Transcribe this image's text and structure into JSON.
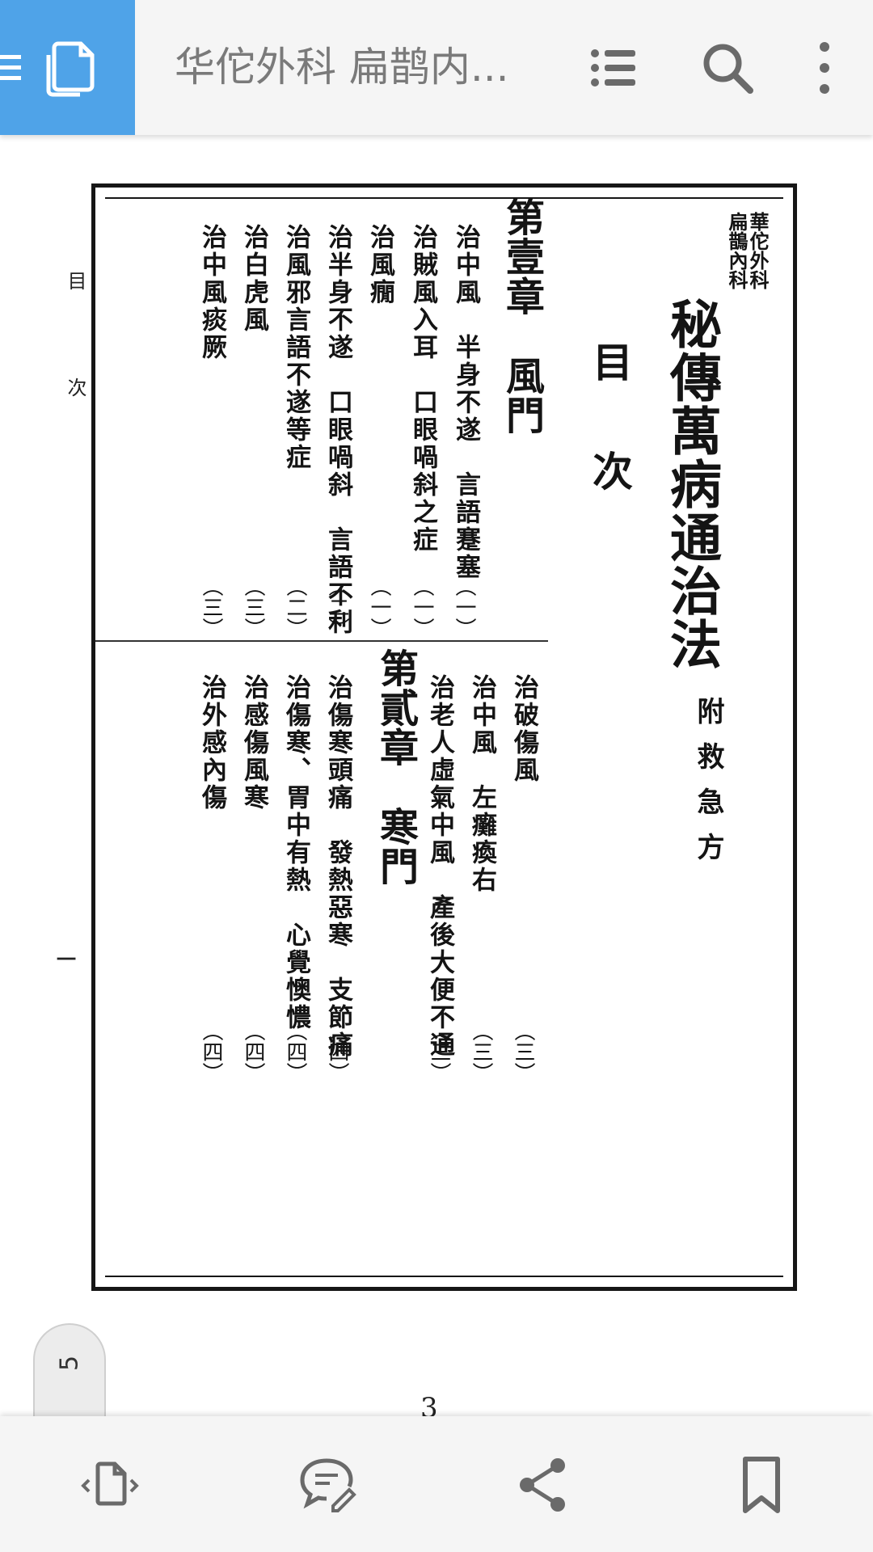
{
  "app": {
    "title": "华佗外科 扁鹊内...",
    "icons": {
      "menu": "hamburger-icon",
      "copy": "copy-pages-icon",
      "toc": "list-icon",
      "search": "search-icon",
      "more": "more-vertical-icon"
    },
    "accent_color": "#4fa3e8"
  },
  "document": {
    "book_header": "華佗外科",
    "book_header_2": "扁鵲內科",
    "book_title": "秘傳萬病通治法",
    "toc_heading_1": "目",
    "toc_heading_2": "次",
    "appendix": "附救急方",
    "margin_label_top": "目",
    "margin_label_bottom": "次",
    "margin_dash": "一",
    "chapter1": {
      "title": "第壹章　風門",
      "entries": [
        {
          "text": "治中風　半身不遂　言語蹇塞",
          "page": "（一）"
        },
        {
          "text": "治賊風入耳　口眼喎斜之症",
          "page": "（一）"
        },
        {
          "text": "治風癇",
          "page": "（一）"
        },
        {
          "text": "治半身不遂　口眼喎斜　言語不利",
          "page": "（二）"
        },
        {
          "text": "治風邪言語不遂等症",
          "page": "（二）"
        },
        {
          "text": "治白虎風",
          "page": "（三）"
        },
        {
          "text": "治中風痰厥",
          "page": "（三）"
        }
      ]
    },
    "chapter1_continued": [
      {
        "text": "治破傷風",
        "page": "（三）"
      },
      {
        "text": "治中風　左癱瘓右",
        "page": "（三）"
      },
      {
        "text": "治老人虛氣中風　產後大便不通",
        "page": "（三）"
      }
    ],
    "chapter2": {
      "title": "第貳章　寒門",
      "entries": [
        {
          "text": "治傷寒頭痛　發熱惡寒　支節痛",
          "page": "（四）"
        },
        {
          "text": "治傷寒、胃中有熱　心覺懊憹",
          "page": "（四）"
        },
        {
          "text": "治感傷風寒",
          "page": "（四）"
        },
        {
          "text": "治外感內傷",
          "page": "（四）"
        }
      ]
    },
    "printed_page_number": "3"
  },
  "page_indicator": "5",
  "bottom_bar": {
    "icons": [
      "page-navigate-icon",
      "comment-edit-icon",
      "share-icon",
      "bookmark-icon"
    ]
  }
}
